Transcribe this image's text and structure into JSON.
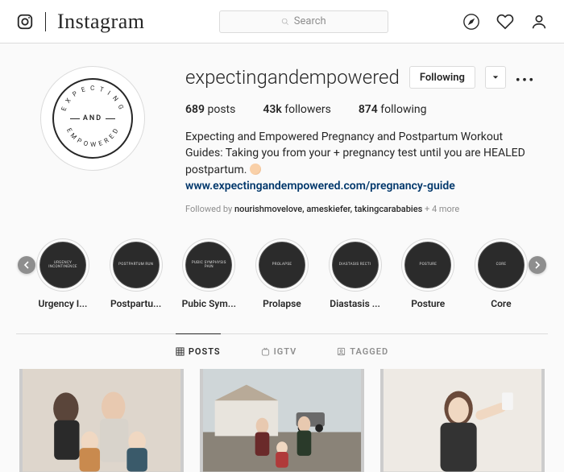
{
  "brand": "Instagram",
  "search": {
    "placeholder": "Search"
  },
  "profile": {
    "username": "expectingandempowered",
    "avatar_text": "AND",
    "following_btn": "Following",
    "stats": {
      "posts_count": "689",
      "posts_label": "posts",
      "followers_count": "43k",
      "followers_label": "followers",
      "following_count": "874",
      "following_label": "following"
    },
    "bio_text": "Expecting and Empowered Pregnancy and Postpartum Workout Guides: Taking you from your + pregnancy test until you are HEALED postpartum.",
    "bio_link": "www.expectingandempowered.com/pregnancy-guide",
    "followed_by_prefix": "Followed by",
    "followed_by_names": "nourishmovelove, ameskiefer, takingcarababies",
    "followed_by_more": "+ 4 more"
  },
  "highlights": [
    {
      "inner": "Urgency Incontinence",
      "label": "Urgency I..."
    },
    {
      "inner": "Postpartum Run",
      "label": "Postpartu..."
    },
    {
      "inner": "Pubic Symphysis Pain",
      "label": "Pubic Sym..."
    },
    {
      "inner": "Prolapse",
      "label": "Prolapse"
    },
    {
      "inner": "Diastasis Recti",
      "label": "Diastasis ..."
    },
    {
      "inner": "Posture",
      "label": "Posture"
    },
    {
      "inner": "Core",
      "label": "Core"
    }
  ],
  "tabs": {
    "posts": "Posts",
    "igtv": "IGTV",
    "tagged": "Tagged"
  }
}
